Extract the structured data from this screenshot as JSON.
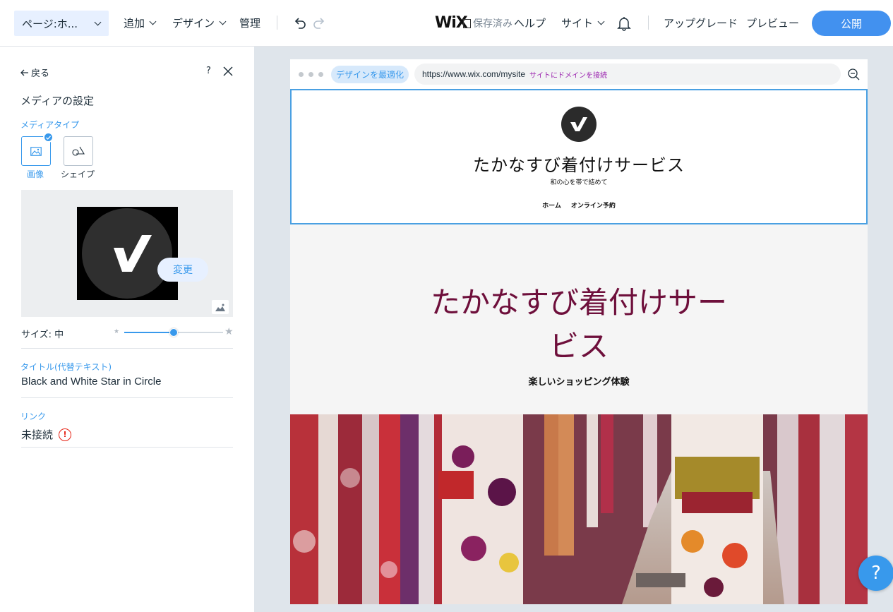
{
  "topbar": {
    "page_selector": "ページ:ホ...",
    "menu": [
      "追加",
      "デザイン",
      "管理"
    ],
    "logo": "WiX",
    "save_status": "保存済み",
    "right_menu": [
      "ヘルプ",
      "サイト"
    ],
    "upgrade": "アップグレード",
    "preview": "プレビュー",
    "publish": "公開"
  },
  "panel": {
    "back": "戻る",
    "help": "?",
    "title": "メディアの設定",
    "media_type_label": "メディアタイプ",
    "media_types": [
      "画像",
      "シェイプ"
    ],
    "change_button": "変更",
    "size_label": "サイズ: 中",
    "size_level_percent": 50,
    "title_label": "タイトル(代替テキスト)",
    "title_value": "Black and White Star in Circle",
    "link_label": "リンク",
    "link_value": "未接続",
    "warn_glyph": "!"
  },
  "browser": {
    "optimize": "デザインを最適化",
    "url": "https://www.wix.com/mysite",
    "connect_domain": "サイトにドメインを接続"
  },
  "site": {
    "title": "たかなすび着付けサービス",
    "tagline": "和の心を帯で結めて",
    "nav": [
      "ホーム",
      "オンライン予約"
    ],
    "hero_title_line1": "たかなすび着付けサー",
    "hero_title_line2": "ビス",
    "hero_subtitle": "楽しいショッピング体験"
  },
  "help_fab": "?",
  "colors": {
    "accent": "#3899ec",
    "publish": "#4291ef",
    "hero_title": "#6e0f3b",
    "warning": "#e62214"
  }
}
